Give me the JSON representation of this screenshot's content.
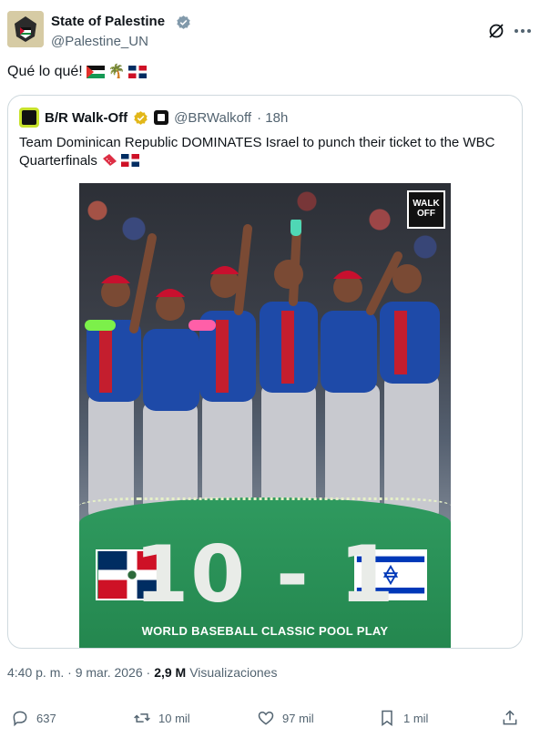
{
  "author": {
    "name": "State of Palestine",
    "handle": "@Palestine_UN",
    "verified": true
  },
  "tweet": {
    "text": "Qué lo qué!",
    "emojis": [
      "palestine-flag",
      "palm-tree",
      "dominican-republic-flag"
    ]
  },
  "quoted": {
    "name": "B/R Walk-Off",
    "handle": "@BRWalkoff",
    "time": "· 18h",
    "text": "Team Dominican Republic DOMINATES Israel to punch their ticket to the WBC Quarterfinals",
    "emojis": [
      "ticket",
      "dominican-republic-flag"
    ],
    "image": {
      "logo_line1": "WALK",
      "logo_line2": "OFF",
      "score": "10 - 1",
      "caption": "WORLD BASEBALL CLASSIC POOL PLAY"
    }
  },
  "meta": {
    "timestamp": "4:40 p. m. · 9 mar. 2026 ·",
    "views": "2,9 M",
    "views_label": "Visualizaciones"
  },
  "actions": {
    "replies": "637",
    "reposts": "10 mil",
    "likes": "97 mil",
    "bookmarks": "1 mil"
  },
  "colors": {
    "verified_blue": "#829aab",
    "gold_badge": "#e2b719",
    "field_green": "#2a9059",
    "text_secondary": "#536471"
  }
}
